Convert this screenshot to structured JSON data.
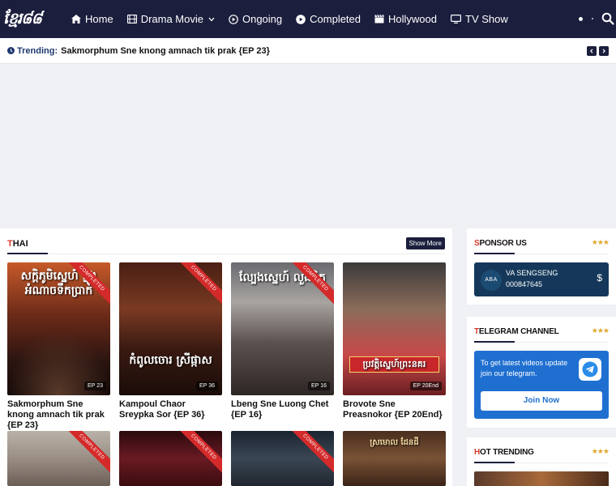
{
  "header": {
    "logo_text": "ខ្មែរ៨៨",
    "nav": [
      {
        "label": "Home",
        "icon": "home-icon"
      },
      {
        "label": "Drama Movie",
        "icon": "film-icon"
      },
      {
        "label": "Ongoing",
        "icon": "play-circle-icon"
      },
      {
        "label": "Completed",
        "icon": "play-circle-filled-icon"
      },
      {
        "label": "Hollywood",
        "icon": "clapperboard-icon"
      },
      {
        "label": "TV Show",
        "icon": "tv-icon"
      }
    ]
  },
  "trending": {
    "label": "Trending:",
    "text": "Sakmorphum Sne knong amnach tik prak {EP 23}"
  },
  "thai_section": {
    "title_first": "T",
    "title_rest": "HAI",
    "show_more": "Show More",
    "ribbon_text": "COMPLETED",
    "cards": [
      {
        "title": "Sakmorphum Sne knong amnach tik prak {EP 23}",
        "ep": "EP 23",
        "poster_text": "សក្ដិភូមិស្នេហ៍ ក្នុងអំណាចទឹកប្រាក់"
      },
      {
        "title": "Kampoul Chaor Sreypka Sor {EP 36}",
        "ep": "EP 36",
        "poster_text": "កំពូលចោរ ស្រីផ្កាស"
      },
      {
        "title": "Lbeng Sne Luong Chet {EP 16}",
        "ep": "EP 16",
        "poster_text": "ល្បែងស្នេហ៍ លួងចិត្ត"
      },
      {
        "title": "Brovote Sne Preasnokor {EP 20End}",
        "ep": "EP 20End",
        "poster_text": "ប្រវត្តិស្នេហ៍ព្រះនគរ"
      }
    ],
    "row2_poster_text": "ស្រមោល ដែនដី"
  },
  "sidebar": {
    "sponsor": {
      "title_first": "S",
      "title_rest": "PONSOR US",
      "bank": "ABA",
      "name": "VA SENGSENG",
      "number": "000847645",
      "currency": "$"
    },
    "telegram": {
      "title_first": "T",
      "title_rest": "ELEGRAM CHANNEL",
      "text": "To get latest videos update join our telegram.",
      "button": "Join Now"
    },
    "hot": {
      "title_first": "H",
      "title_rest": "OT TRENDING"
    },
    "stars": "★★★"
  },
  "colors": {
    "header_bg": "#1b1e3d",
    "accent_red": "#d63b2e",
    "telegram_blue": "#1f6fd0",
    "sponsor_bg": "#15385a",
    "stars": "#e0a82e"
  }
}
